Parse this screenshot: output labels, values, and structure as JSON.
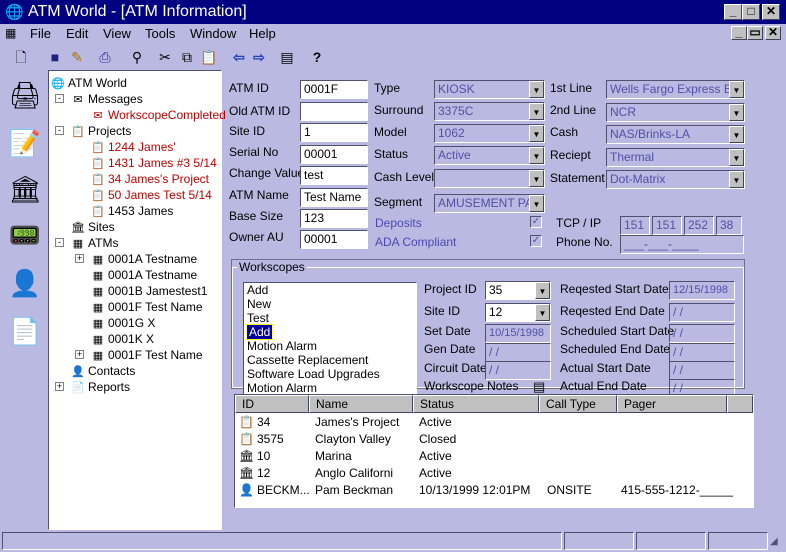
{
  "window": {
    "app_icon": "globe-icon",
    "title": "ATM World - [ATM Information]",
    "min": "_",
    "max": "□",
    "close": "✕",
    "doc_restore": "▭",
    "doc_min": "_",
    "doc_close": "✕"
  },
  "menu": [
    "File",
    "Edit",
    "View",
    "Tools",
    "Window",
    "Help"
  ],
  "toolbar": [
    "new-icon",
    "save-icon",
    "edit-icon",
    "print-icon",
    "find-icon",
    "cut-icon",
    "copy-icon",
    "paste-icon",
    "back-icon",
    "forward-icon",
    "notes-icon",
    "help-icon"
  ],
  "sidebar": [
    "atm-icon",
    "notepad-icon",
    "bank-icon",
    "terminal-icon",
    "contacts-icon",
    "document-icon"
  ],
  "tree": {
    "root": "ATM World",
    "messages": "Messages",
    "msg_item": "WorkscopeCompleted",
    "projects": "Projects",
    "project_items": [
      "1244 James'",
      "1431 James #3 5/14",
      "34 James's Project",
      "50 James Test 5/14",
      "1453 James"
    ],
    "sites": "Sites",
    "atms": "ATMs",
    "atm_items": [
      "0001A Testname",
      "0001A Testname",
      "0001B Jamestest1",
      "0001F Test Name",
      "0001G X",
      "0001K X",
      "0001F Test Name"
    ],
    "contacts": "Contacts",
    "reports": "Reports"
  },
  "form": {
    "atm_id_label": "ATM ID",
    "atm_id": "0001F",
    "old_atm_id_label": "Old ATM ID",
    "old_atm_id": "",
    "site_id_label": "Site ID",
    "site_id": "1",
    "serial_label": "Serial No",
    "serial": "00001",
    "change_label": "Change Value",
    "change": "test",
    "name_label": "ATM Name",
    "name": "Test Name",
    "base_label": "Base Size",
    "base": "123",
    "owner_label": "Owner AU",
    "owner": "00001",
    "type_label": "Type",
    "type": "KIOSK",
    "surround_label": "Surround",
    "surround": "3375C",
    "model_label": "Model",
    "model": "1062",
    "status_label": "Status",
    "status": "Active",
    "cash_level_label": "Cash Level",
    "cash_level": "",
    "segment_label": "Segment",
    "segment": "AMUSEMENT PAF",
    "deposits_label": "Deposits",
    "ada_label": "ADA Compliant",
    "deposits_checked": "✓",
    "ada_checked": "✓",
    "line1_label": "1st Line",
    "line1": "Wells Fargo Express Ban",
    "line2_label": "2nd Line",
    "line2": "NCR",
    "cash_label": "Cash",
    "cash": "NAS/Brinks-LA",
    "receipt_label": "Reciept",
    "receipt": "Thermal",
    "statement_label": "Statement",
    "statement": "Dot-Matrix",
    "tcp_label": "TCP / IP",
    "ip": [
      "151",
      "151",
      "252",
      "38"
    ],
    "phone_label": "Phone No.",
    "phone": "___-___-____"
  },
  "workscopes": {
    "legend": "Workscopes",
    "items": [
      "Add",
      "New",
      "Test",
      "Add",
      "Motion Alarm",
      "Cassette Replacement",
      "Software Load Upgrades",
      "Motion Alarm"
    ],
    "selected_index": 3,
    "project_label": "Project ID",
    "project": "35",
    "site_label": "Site ID",
    "site": "12",
    "set_label": "Set Date",
    "set": "10/15/1998",
    "gen_label": "Gen Date",
    "gen": "/ /",
    "circuit_label": "Circuit Date",
    "circuit": "/ /",
    "notes_label": "Workscope Notes",
    "rs_label": "Reqested Start Date",
    "rs": "12/15/1998",
    "re_label": "Reqested End Date",
    "re": "/ /",
    "ss_label": "Scheduled Start Date",
    "ss": "/ /",
    "se_label": "Scheduled End Date",
    "se": "/ /",
    "as_label": "Actual Start Date",
    "as": "/ /",
    "ae_label": "Actual End Date",
    "ae": "/ /"
  },
  "grid": {
    "headers": [
      "ID",
      "Name",
      "Status",
      "Call Type",
      "Pager"
    ],
    "rows": [
      {
        "icon": "project-icon",
        "id": "34",
        "name": "James's Project",
        "status": "Active",
        "call": "",
        "pager": ""
      },
      {
        "icon": "project-icon",
        "id": "3575",
        "name": "Clayton Valley",
        "status": "Closed",
        "call": "",
        "pager": ""
      },
      {
        "icon": "bank-icon",
        "id": "10",
        "name": "Marina",
        "status": "Active",
        "call": "",
        "pager": ""
      },
      {
        "icon": "bank-icon",
        "id": "12",
        "name": "Anglo Californi",
        "status": "Active",
        "call": "",
        "pager": ""
      },
      {
        "icon": "person-icon",
        "id": "BECKM...",
        "name": "Pam Beckman",
        "status": "10/13/1999 12:01PM",
        "call": "ONSITE",
        "pager": "415-555-1212-_____"
      }
    ]
  }
}
